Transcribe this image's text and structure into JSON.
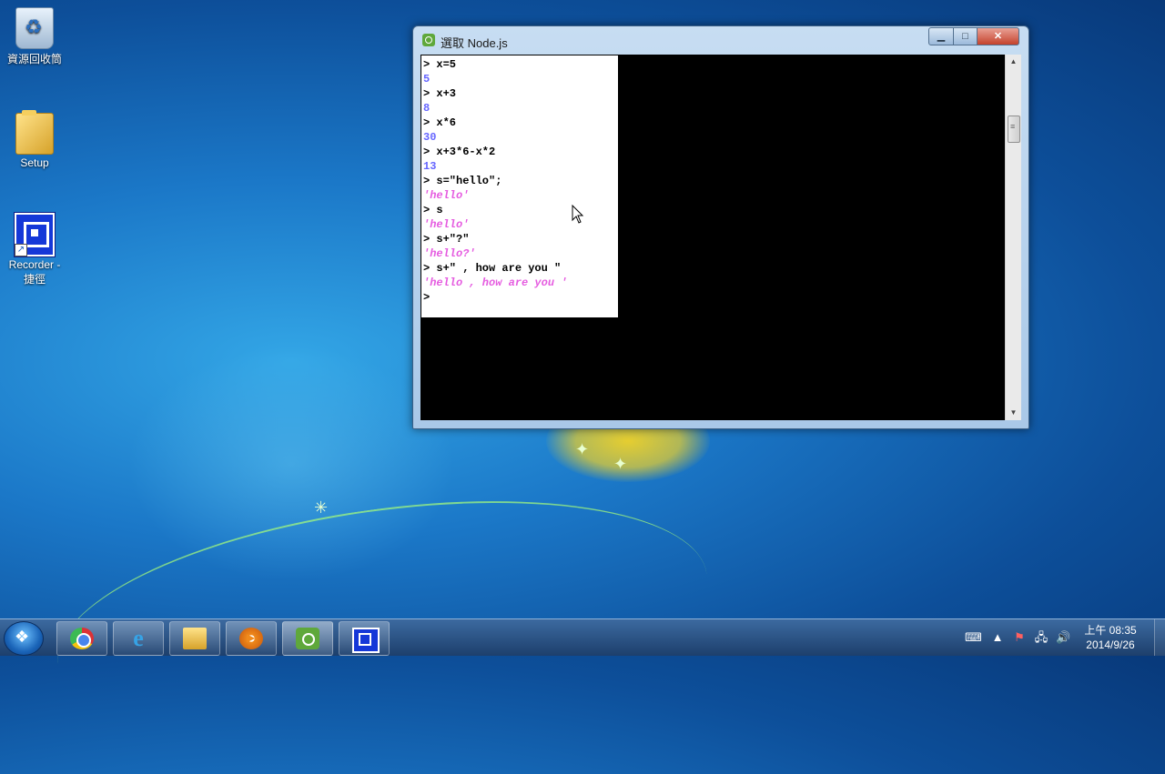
{
  "desktop": {
    "icons": [
      {
        "label_line1": "資源回收筒",
        "label_line2": ""
      },
      {
        "label_line1": "Setup",
        "label_line2": ""
      },
      {
        "label_line1": "Recorder -",
        "label_line2": "捷徑"
      }
    ]
  },
  "window": {
    "title": "選取 Node.js",
    "controls": {
      "minimize": "▁",
      "maximize": "□",
      "close": "✕"
    },
    "console_lines": [
      {
        "text": "> x=5",
        "kind": "prompt"
      },
      {
        "text": "5",
        "kind": "num"
      },
      {
        "text": "> x+3",
        "kind": "prompt"
      },
      {
        "text": "8",
        "kind": "num"
      },
      {
        "text": "> x*6",
        "kind": "prompt"
      },
      {
        "text": "30",
        "kind": "num"
      },
      {
        "text": "> x+3*6-x*2",
        "kind": "prompt"
      },
      {
        "text": "13",
        "kind": "num"
      },
      {
        "text": "> s=\"hello\";",
        "kind": "prompt"
      },
      {
        "text": "'hello'",
        "kind": "str"
      },
      {
        "text": "> s",
        "kind": "prompt"
      },
      {
        "text": "'hello'",
        "kind": "str"
      },
      {
        "text": "> s+\"?\"",
        "kind": "prompt"
      },
      {
        "text": "'hello?'",
        "kind": "str"
      },
      {
        "text": "> s+\" , how are you \"",
        "kind": "prompt"
      },
      {
        "text": "'hello , how are you '",
        "kind": "str"
      },
      {
        "text": ">",
        "kind": "prompt"
      }
    ],
    "scroll": {
      "up": "▲",
      "down": "▼"
    }
  },
  "taskbar": {
    "apps": [
      "chrome",
      "internet-explorer",
      "windows-explorer",
      "media-player",
      "node-js",
      "recorder"
    ],
    "clock": {
      "time": "上午 08:35",
      "date": "2014/9/26"
    }
  },
  "colors": {
    "prompt": "#000000",
    "num": "#6666ff",
    "str": "#e55be0"
  }
}
